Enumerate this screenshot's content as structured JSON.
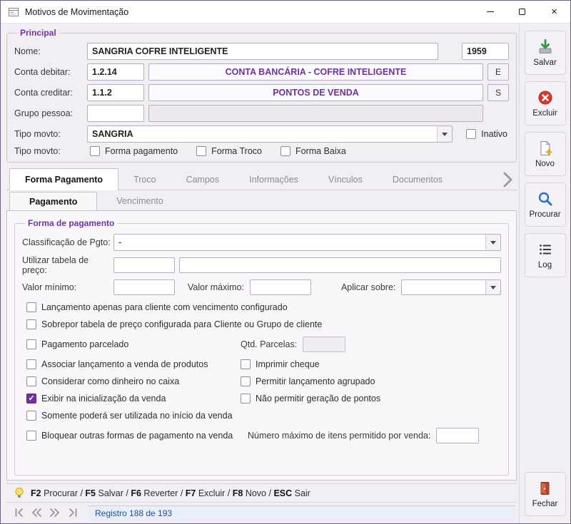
{
  "window": {
    "title": "Motivos de Movimentação"
  },
  "principal": {
    "legend": "Principal",
    "nome": {
      "label": "Nome:",
      "value": "SANGRIA COFRE INTELIGENTE",
      "code": "1959"
    },
    "conta_debitar": {
      "label": "Conta debitar:",
      "code": "1.2.14",
      "name": "CONTA BANCÁRIA - COFRE INTELIGENTE",
      "button": "E"
    },
    "conta_creditar": {
      "label": "Conta creditar:",
      "code": "1.1.2",
      "name": "PONTOS DE VENDA",
      "button": "S"
    },
    "grupo_pessoa": {
      "label": "Grupo pessoa:",
      "code": "",
      "name": ""
    },
    "tipo_movto": {
      "label": "Tipo movto:",
      "value": "SANGRIA",
      "inativo": {
        "label": "Inativo",
        "checked": false
      }
    },
    "tipo_movto_flags": {
      "label": "Tipo movto:",
      "options": [
        {
          "label": "Forma pagamento",
          "checked": false
        },
        {
          "label": "Forma Troco",
          "checked": false
        },
        {
          "label": "Forma Baixa",
          "checked": false
        }
      ]
    }
  },
  "tabs": {
    "active": "Forma Pagamento",
    "items": [
      {
        "label": "Forma Pagamento"
      },
      {
        "label": "Troco"
      },
      {
        "label": "Campos"
      },
      {
        "label": "Informações"
      },
      {
        "label": "Vínculos"
      },
      {
        "label": "Documentos"
      }
    ]
  },
  "subtabs": {
    "active": "Pagamento",
    "items": [
      {
        "label": "Pagamento"
      },
      {
        "label": "Vencimento"
      }
    ]
  },
  "payment": {
    "legend": "Forma de pagamento",
    "classificacao": {
      "label": "Classificação de Pgto:",
      "value": "-"
    },
    "tabela_preco": {
      "label": "Utilizar tabela de preço:",
      "code": "",
      "name": ""
    },
    "valor_minimo": {
      "label": "Valor mínimo:",
      "value": ""
    },
    "valor_maximo": {
      "label": "Valor máximo:",
      "value": ""
    },
    "aplicar_sobre": {
      "label": "Aplicar sobre:",
      "value": ""
    },
    "checkboxes": [
      {
        "label": "Lançamento apenas para cliente com vencimento configurado",
        "checked": false
      },
      {
        "label": "Sobrepor tabela de preço configurada para Cliente ou Grupo de cliente",
        "checked": false
      },
      {
        "label": "Pagamento parcelado",
        "checked": false
      },
      {
        "label": "Associar lançamento a venda de produtos",
        "checked": false
      },
      {
        "label": "Considerar como dinheiro no caixa",
        "checked": false
      },
      {
        "label": "Exibir na inicialização da venda",
        "checked": true
      },
      {
        "label": "Somente poderá ser utilizada no início da venda",
        "checked": false
      },
      {
        "label": "Bloquear outras formas de pagamento na venda",
        "checked": false
      }
    ],
    "qtd_parcelas": {
      "label": "Qtd. Parcelas:",
      "value": ""
    },
    "imprimir_cheque": {
      "label": "Imprimir cheque",
      "checked": false
    },
    "permitir_agrupado": {
      "label": "Permitir lançamento agrupado",
      "checked": false
    },
    "nao_permitir_pontos": {
      "label": "Não permitir geração de pontos",
      "checked": false
    },
    "num_max_itens": {
      "label": "Número máximo de itens permitido por venda:",
      "value": ""
    }
  },
  "statusbar": {
    "parts": [
      {
        "key": "F2",
        "text": " Procurar / "
      },
      {
        "key": "F5",
        "text": " Salvar / "
      },
      {
        "key": "F6",
        "text": " Reverter / "
      },
      {
        "key": "F7",
        "text": " Excluir / "
      },
      {
        "key": "F8",
        "text": " Novo / "
      },
      {
        "key": "ESC",
        "text": " Sair"
      }
    ]
  },
  "nav": {
    "registro": "Registro 188 de 193"
  },
  "sidebar": {
    "buttons": [
      {
        "label": "Salvar"
      },
      {
        "label": "Excluir"
      },
      {
        "label": "Novo"
      },
      {
        "label": "Procurar"
      },
      {
        "label": "Log"
      },
      {
        "label": "Fechar"
      }
    ]
  },
  "colors": {
    "accent_purple": "#7232a2",
    "account_text": "#7030a0",
    "status_blue": "#1b4e9b",
    "delete_red": "#d63a2e",
    "save_green": "#2e9e3f"
  }
}
